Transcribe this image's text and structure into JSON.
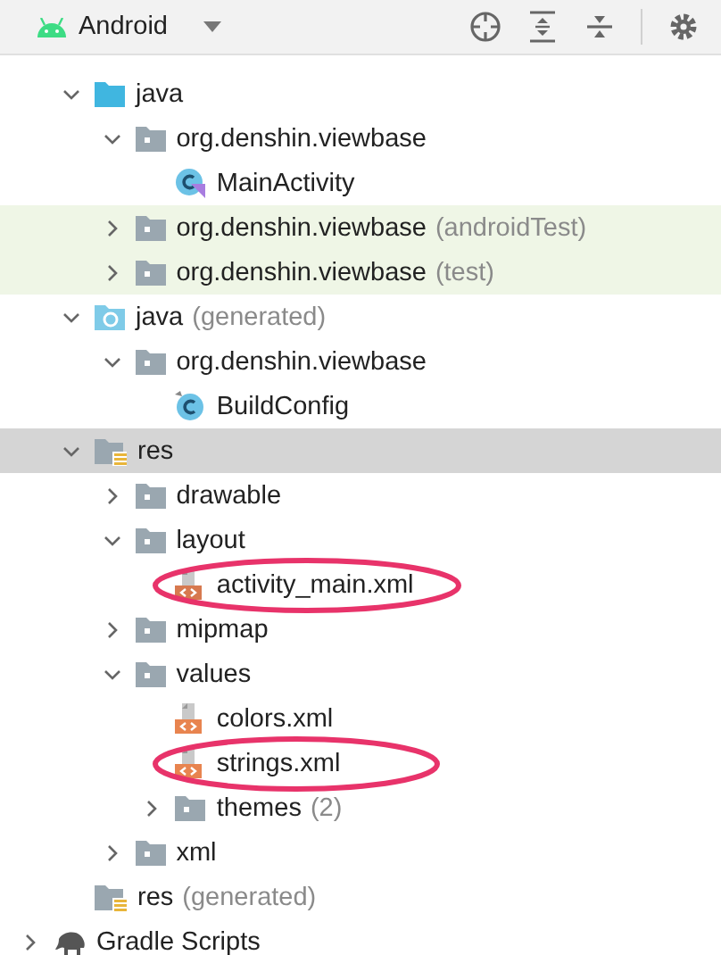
{
  "header": {
    "view": "Android"
  },
  "tree": [
    {
      "label": "java",
      "kind": "java-folder",
      "expanded": true,
      "children": [
        {
          "label": "org.denshin.viewbase",
          "kind": "package",
          "expanded": true,
          "children": [
            {
              "label": "MainActivity",
              "kind": "kotlin-class"
            }
          ]
        },
        {
          "label": "org.denshin.viewbase",
          "suffix": "(androidTest)",
          "kind": "package",
          "expanded": false,
          "test_source": true
        },
        {
          "label": "org.denshin.viewbase",
          "suffix": "(test)",
          "kind": "package",
          "expanded": false,
          "test_source": true
        }
      ]
    },
    {
      "label": "java",
      "suffix": "(generated)",
      "kind": "generated-folder",
      "expanded": true,
      "children": [
        {
          "label": "org.denshin.viewbase",
          "kind": "package",
          "expanded": true,
          "children": [
            {
              "label": "BuildConfig",
              "kind": "class"
            }
          ]
        }
      ]
    },
    {
      "label": "res",
      "kind": "res-folder",
      "expanded": true,
      "selected": true,
      "children": [
        {
          "label": "drawable",
          "kind": "package",
          "expanded": false
        },
        {
          "label": "layout",
          "kind": "package",
          "expanded": true,
          "children": [
            {
              "label": "activity_main.xml",
              "kind": "layout-xml",
              "circled": true
            }
          ]
        },
        {
          "label": "mipmap",
          "kind": "package",
          "expanded": false
        },
        {
          "label": "values",
          "kind": "package",
          "expanded": true,
          "children": [
            {
              "label": "colors.xml",
              "kind": "xml-file"
            },
            {
              "label": "strings.xml",
              "kind": "xml-file",
              "circled": true
            },
            {
              "label": "themes",
              "suffix": "(2)",
              "kind": "package",
              "expanded": false
            }
          ]
        },
        {
          "label": "xml",
          "kind": "package",
          "expanded": false
        }
      ]
    },
    {
      "label": "res",
      "suffix": "(generated)",
      "kind": "res-folder"
    }
  ],
  "root_items": [
    {
      "label": "Gradle Scripts",
      "kind": "gradle",
      "expanded": false
    }
  ]
}
